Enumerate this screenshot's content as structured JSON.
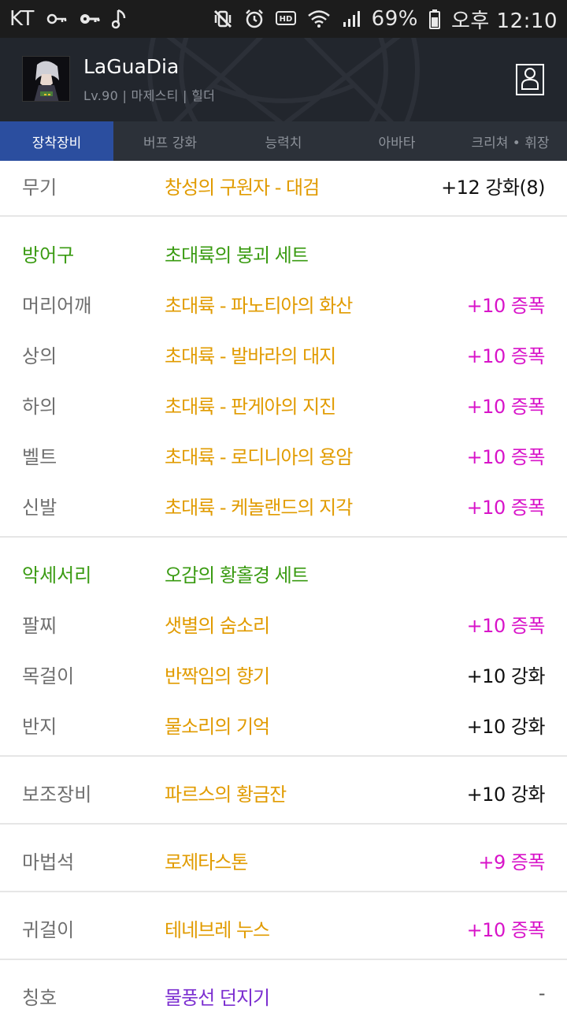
{
  "status_bar": {
    "carrier": "KT",
    "battery": "69%",
    "time": "오후 12:10",
    "hd_label": "HD",
    "icons_left": [
      "key-outline-icon",
      "key-icon",
      "music-note-icon"
    ],
    "icons_right": [
      "vibrate-off-icon",
      "alarm-icon",
      "hd-voice-icon",
      "wifi-icon",
      "signal-icon",
      "battery-icon"
    ]
  },
  "header": {
    "name": "LaGuaDia",
    "meta": "Lv.90 | 마제스티 | 힐더"
  },
  "tabs": [
    {
      "label": "장착장비",
      "active": true
    },
    {
      "label": "버프 강화",
      "active": false
    },
    {
      "label": "능력치",
      "active": false
    },
    {
      "label": "아바타",
      "active": false
    },
    {
      "label": "크리쳐 • 휘장",
      "active": false
    }
  ],
  "equipment": {
    "weapon": {
      "slot": "무기",
      "item": "창성의 구원자 - 대검",
      "value": "+12 강화(8)"
    },
    "armor_set": {
      "slot": "방어구",
      "item": "초대륙의 붕괴 세트"
    },
    "armor": [
      {
        "slot": "머리어깨",
        "item": "초대륙 - 파노티아의 화산",
        "value": "+10 증폭"
      },
      {
        "slot": "상의",
        "item": "초대륙 - 발바라의 대지",
        "value": "+10 증폭"
      },
      {
        "slot": "하의",
        "item": "초대륙 - 판게아의 지진",
        "value": "+10 증폭"
      },
      {
        "slot": "벨트",
        "item": "초대륙 - 로디니아의 용암",
        "value": "+10 증폭"
      },
      {
        "slot": "신발",
        "item": "초대륙 - 케놀랜드의 지각",
        "value": "+10 증폭"
      }
    ],
    "accessory_set": {
      "slot": "악세서리",
      "item": "오감의 황홀경 세트"
    },
    "accessories": [
      {
        "slot": "팔찌",
        "item": "샛별의 숨소리",
        "value": "+10 증폭"
      },
      {
        "slot": "목걸이",
        "item": "반짝임의 향기",
        "value": "+10 강화"
      },
      {
        "slot": "반지",
        "item": "물소리의 기억",
        "value": "+10 강화"
      }
    ],
    "sub": {
      "slot": "보조장비",
      "item": "파르스의 황금잔",
      "value": "+10 강화"
    },
    "magic_stone": {
      "slot": "마법석",
      "item": "로제타스톤",
      "value": "+9 증폭"
    },
    "earring": {
      "slot": "귀걸이",
      "item": "테네브레 누스",
      "value": "+10 증폭"
    },
    "title": {
      "slot": "칭호",
      "item": "물풍선 던지기",
      "value": "-"
    }
  },
  "colors": {
    "epic": "#e19b00",
    "set_green": "#3a9b12",
    "amplify": "#d814c9",
    "title_purple": "#7b2ed0",
    "tab_active": "#2b4e9f"
  }
}
